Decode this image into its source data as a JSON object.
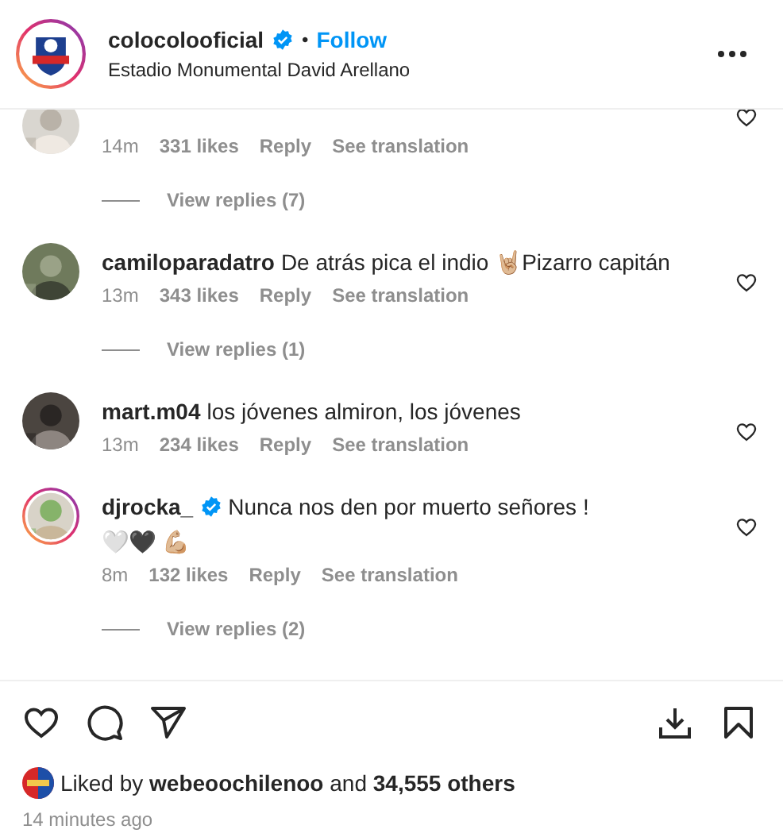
{
  "header": {
    "username": "colocolooficial",
    "verified": true,
    "separator": "•",
    "follow": "Follow",
    "location": "Estadio Monumental David Arellano",
    "story_ring": true
  },
  "comments": [
    {
      "story_ring": false,
      "time": "14m",
      "likes": "331 likes",
      "reply": "Reply",
      "translate": "See translation",
      "view_replies": "View replies (7)"
    },
    {
      "username": "camiloparadatro",
      "text": "De atrás pica el indio 🤘🏼Pizarro capitán",
      "story_ring": false,
      "time": "13m",
      "likes": "343 likes",
      "reply": "Reply",
      "translate": "See translation",
      "view_replies": "View replies (1)"
    },
    {
      "username": "mart.m04",
      "text": "los jóvenes almiron, los jóvenes",
      "story_ring": false,
      "time": "13m",
      "likes": "234 likes",
      "reply": "Reply",
      "translate": "See translation"
    },
    {
      "username": "djrocka_",
      "text": "Nunca nos den por muerto señores !",
      "text_line2": "🤍🖤 💪🏼",
      "verified": true,
      "story_ring": true,
      "time": "8m",
      "likes": "132 likes",
      "reply": "Reply",
      "translate": "See translation",
      "view_replies": "View replies (2)"
    }
  ],
  "actions": {
    "liked": false,
    "saved": false
  },
  "likes": "Liked by **webeoochilenoo** and **34,555 others**",
  "timestamp": "14 minutes ago"
}
